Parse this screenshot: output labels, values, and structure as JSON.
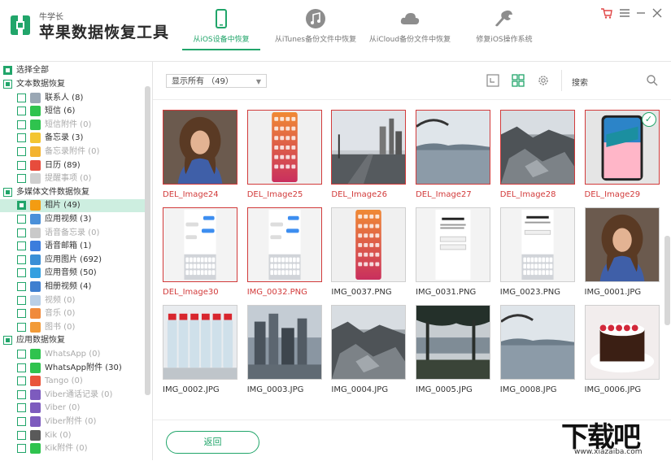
{
  "app": {
    "subtitle": "牛学长",
    "title": "苹果数据恢复工具",
    "brand_color": "#21a56a",
    "tabs": [
      {
        "label": "从iOS设备中恢复",
        "icon": "phone-icon",
        "active": true
      },
      {
        "label": "从iTunes备份文件中恢复",
        "icon": "music-note-icon",
        "active": false
      },
      {
        "label": "从iCloud备份文件中恢复",
        "icon": "cloud-icon",
        "active": false
      },
      {
        "label": "修复iOS操作系统",
        "icon": "wrench-icon",
        "active": false
      }
    ]
  },
  "sidebar": {
    "select_all": "选择全部",
    "groups": [
      {
        "label": "文本数据恢复",
        "items": [
          {
            "label": "联系人 (8)",
            "icon": "contacts-icon",
            "color": "#9aa7b4",
            "dim": false
          },
          {
            "label": "短信 (6)",
            "icon": "messages-icon",
            "color": "#2fc34e",
            "dim": false
          },
          {
            "label": "短信附件 (0)",
            "icon": "attachment-icon",
            "color": "#2fc34e",
            "dim": true
          },
          {
            "label": "备忘录 (3)",
            "icon": "notes-icon",
            "color": "#f3c531",
            "dim": false
          },
          {
            "label": "备忘录附件 (0)",
            "icon": "attachment-icon",
            "color": "#f3b331",
            "dim": true
          },
          {
            "label": "日历 (89)",
            "icon": "calendar-icon",
            "color": "#e74c3c",
            "dim": false
          },
          {
            "label": "提醒事项 (0)",
            "icon": "reminder-icon",
            "color": "#cfcfcf",
            "dim": true
          }
        ]
      },
      {
        "label": "多媒体文件数据恢复",
        "items": [
          {
            "label": "相片 (49)",
            "icon": "photos-icon",
            "color": "#f39c12",
            "dim": false,
            "selected": true
          },
          {
            "label": "应用视频 (3)",
            "icon": "video-icon",
            "color": "#4a90d9",
            "dim": false
          },
          {
            "label": "语音备忘录 (0)",
            "icon": "voice-memo-icon",
            "color": "#c9c9c9",
            "dim": true
          },
          {
            "label": "语音邮箱 (1)",
            "icon": "voicemail-icon",
            "color": "#3b7ddd",
            "dim": false
          },
          {
            "label": "应用图片 (692)",
            "icon": "app-photos-icon",
            "color": "#3a8fd6",
            "dim": false
          },
          {
            "label": "应用音频 (50)",
            "icon": "app-audio-icon",
            "color": "#35a0e0",
            "dim": false
          },
          {
            "label": "相册视频 (4)",
            "icon": "album-video-icon",
            "color": "#3f7fd0",
            "dim": false
          },
          {
            "label": "视频 (0)",
            "icon": "video-icon",
            "color": "#b9cfe6",
            "dim": true
          },
          {
            "label": "音乐 (0)",
            "icon": "music-icon",
            "color": "#f08a3c",
            "dim": true
          },
          {
            "label": "图书 (0)",
            "icon": "books-icon",
            "color": "#f29b38",
            "dim": true
          }
        ]
      },
      {
        "label": "应用数据恢复",
        "items": [
          {
            "label": "WhatsApp (0)",
            "icon": "whatsapp-icon",
            "color": "#2fc34e",
            "dim": true
          },
          {
            "label": "WhatsApp附件 (30)",
            "icon": "whatsapp-attachment-icon",
            "color": "#2fc34e",
            "dim": false
          },
          {
            "label": "Tango (0)",
            "icon": "tango-icon",
            "color": "#e9553b",
            "dim": true
          },
          {
            "label": "Viber通话记录 (0)",
            "icon": "viber-icon",
            "color": "#7d5bbe",
            "dim": true
          },
          {
            "label": "Viber (0)",
            "icon": "viber-icon",
            "color": "#7d5bbe",
            "dim": true
          },
          {
            "label": "Viber附件 (0)",
            "icon": "viber-attachment-icon",
            "color": "#7d5bbe",
            "dim": true
          },
          {
            "label": "Kik (0)",
            "icon": "kik-icon",
            "color": "#5a5a5a",
            "dim": true
          },
          {
            "label": "Kik附件 (0)",
            "icon": "kik-attachment-icon",
            "color": "#2fc34e",
            "dim": true
          }
        ]
      }
    ]
  },
  "toolbar": {
    "filter_value": "显示所有 （49）",
    "search_label": "搜索"
  },
  "photos": [
    {
      "name": "DEL_Image24",
      "deleted": true,
      "kind": "portrait"
    },
    {
      "name": "DEL_Image25",
      "deleted": true,
      "kind": "phone-home"
    },
    {
      "name": "DEL_Image26",
      "deleted": true,
      "kind": "street"
    },
    {
      "name": "DEL_Image27",
      "deleted": true,
      "kind": "harbor"
    },
    {
      "name": "DEL_Image28",
      "deleted": true,
      "kind": "rocks"
    },
    {
      "name": "DEL_Image29",
      "deleted": true,
      "kind": "phone-product",
      "checked": true
    },
    {
      "name": "DEL_Image30",
      "deleted": true,
      "kind": "chat"
    },
    {
      "name": "IMG_0032.PNG",
      "deleted": true,
      "kind": "chat"
    },
    {
      "name": "IMG_0037.PNG",
      "deleted": false,
      "kind": "phone-home"
    },
    {
      "name": "IMG_0031.PNG",
      "deleted": false,
      "kind": "setup"
    },
    {
      "name": "IMG_0023.PNG",
      "deleted": false,
      "kind": "setup-keyboard"
    },
    {
      "name": "IMG_0001.JPG",
      "deleted": false,
      "kind": "portrait"
    },
    {
      "name": "IMG_0002.JPG",
      "deleted": false,
      "kind": "bottles"
    },
    {
      "name": "IMG_0003.JPG",
      "deleted": false,
      "kind": "city"
    },
    {
      "name": "IMG_0004.JPG",
      "deleted": false,
      "kind": "rocks"
    },
    {
      "name": "IMG_0005.JPG",
      "deleted": false,
      "kind": "trees"
    },
    {
      "name": "IMG_0008.JPG",
      "deleted": false,
      "kind": "harbor"
    },
    {
      "name": "IMG_0006.JPG",
      "deleted": false,
      "kind": "cake"
    }
  ],
  "footer": {
    "back_label": "返回"
  },
  "watermark": {
    "text": "下载吧",
    "url": "www.xiazaiba.com"
  }
}
